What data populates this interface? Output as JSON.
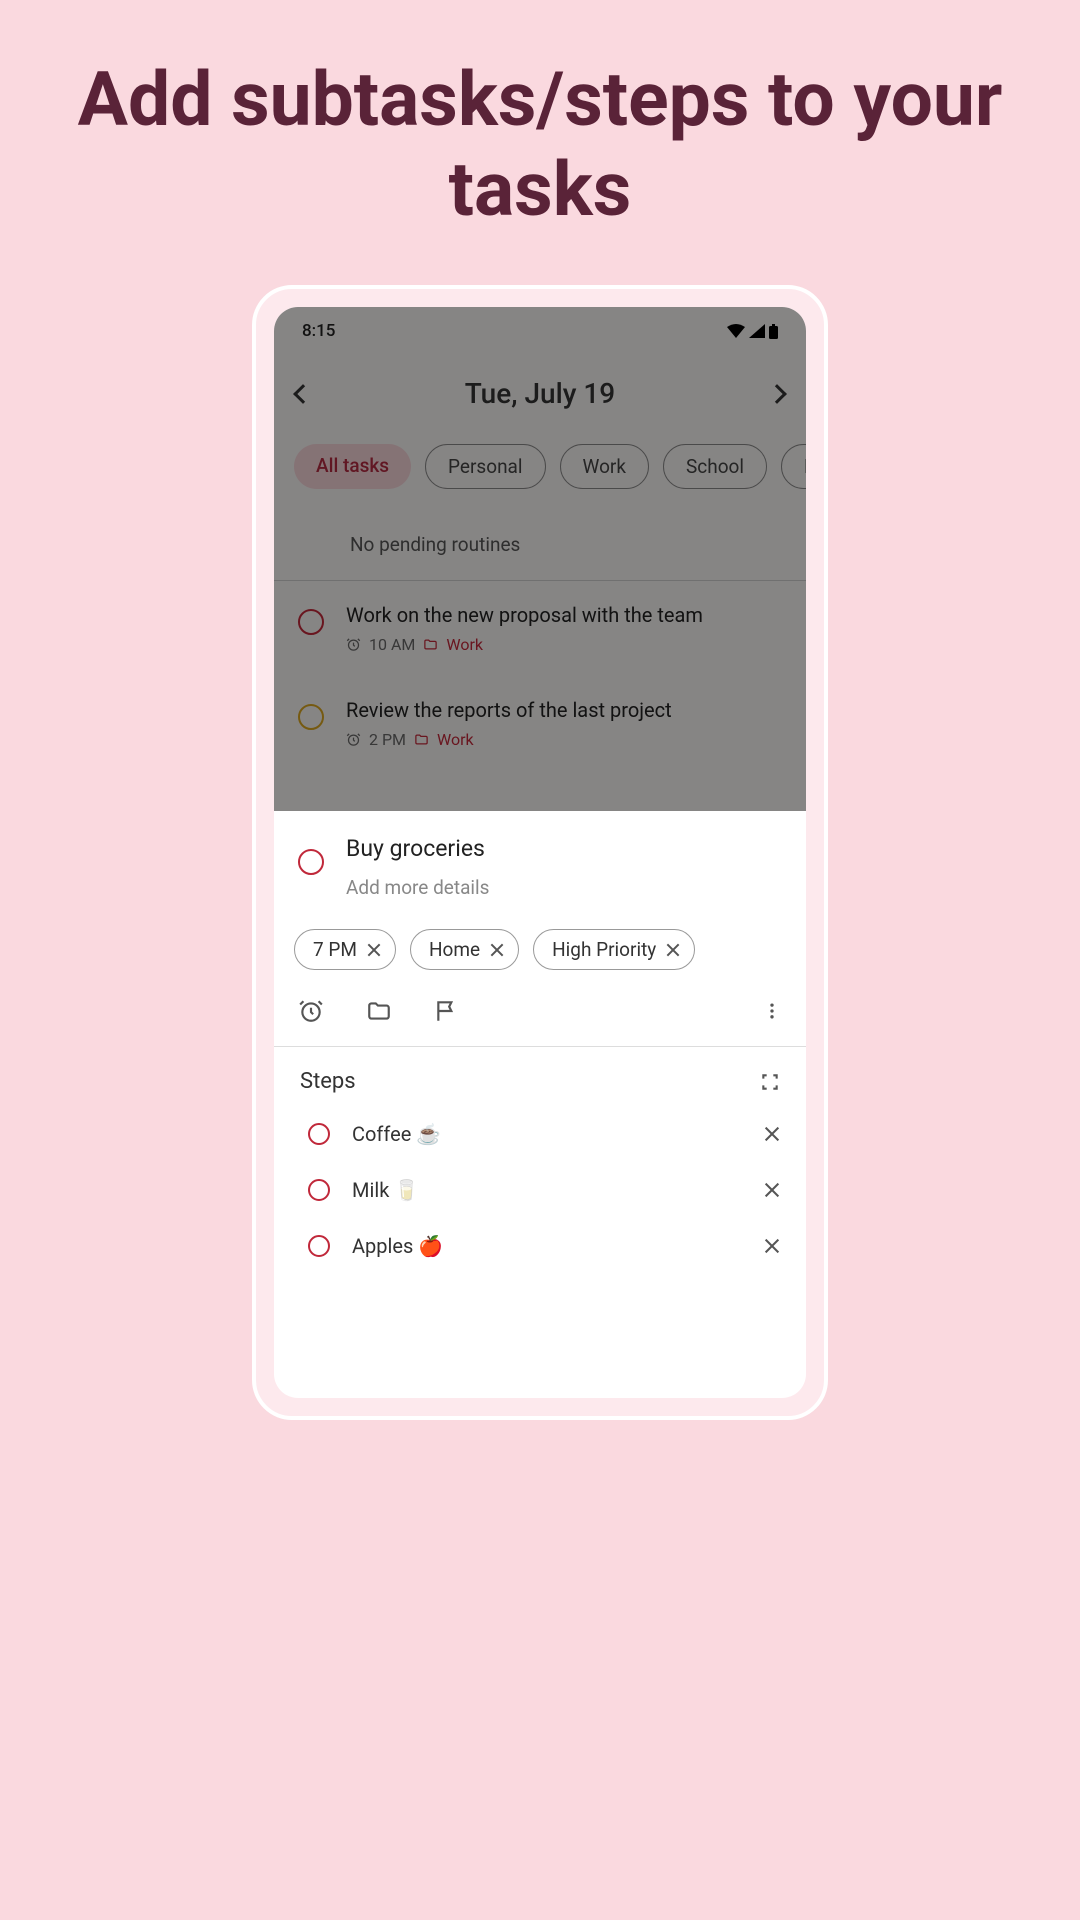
{
  "promo_title": "Add subtasks/steps to your tasks",
  "status_bar": {
    "time": "8:15"
  },
  "date_header": {
    "title": "Tue, July 19"
  },
  "filters": [
    {
      "label": "All tasks",
      "active": true
    },
    {
      "label": "Personal",
      "active": false
    },
    {
      "label": "Work",
      "active": false
    },
    {
      "label": "School",
      "active": false
    },
    {
      "label": "H",
      "active": false
    }
  ],
  "pending_message": "No pending routines",
  "tasks": [
    {
      "title": "Work on the new proposal with the team",
      "time": "10 AM",
      "category": "Work",
      "color": "red"
    },
    {
      "title": "Review the reports of the last project",
      "time": "2 PM",
      "category": "Work",
      "color": "yellow"
    }
  ],
  "sheet": {
    "task_title": "Buy groceries",
    "details_placeholder": "Add more details",
    "tags": [
      {
        "label": "7 PM"
      },
      {
        "label": "Home"
      },
      {
        "label": "High Priority"
      }
    ],
    "steps_title": "Steps",
    "steps": [
      {
        "label": "Coffee ☕"
      },
      {
        "label": "Milk 🥛"
      },
      {
        "label": "Apples 🍎"
      }
    ]
  }
}
